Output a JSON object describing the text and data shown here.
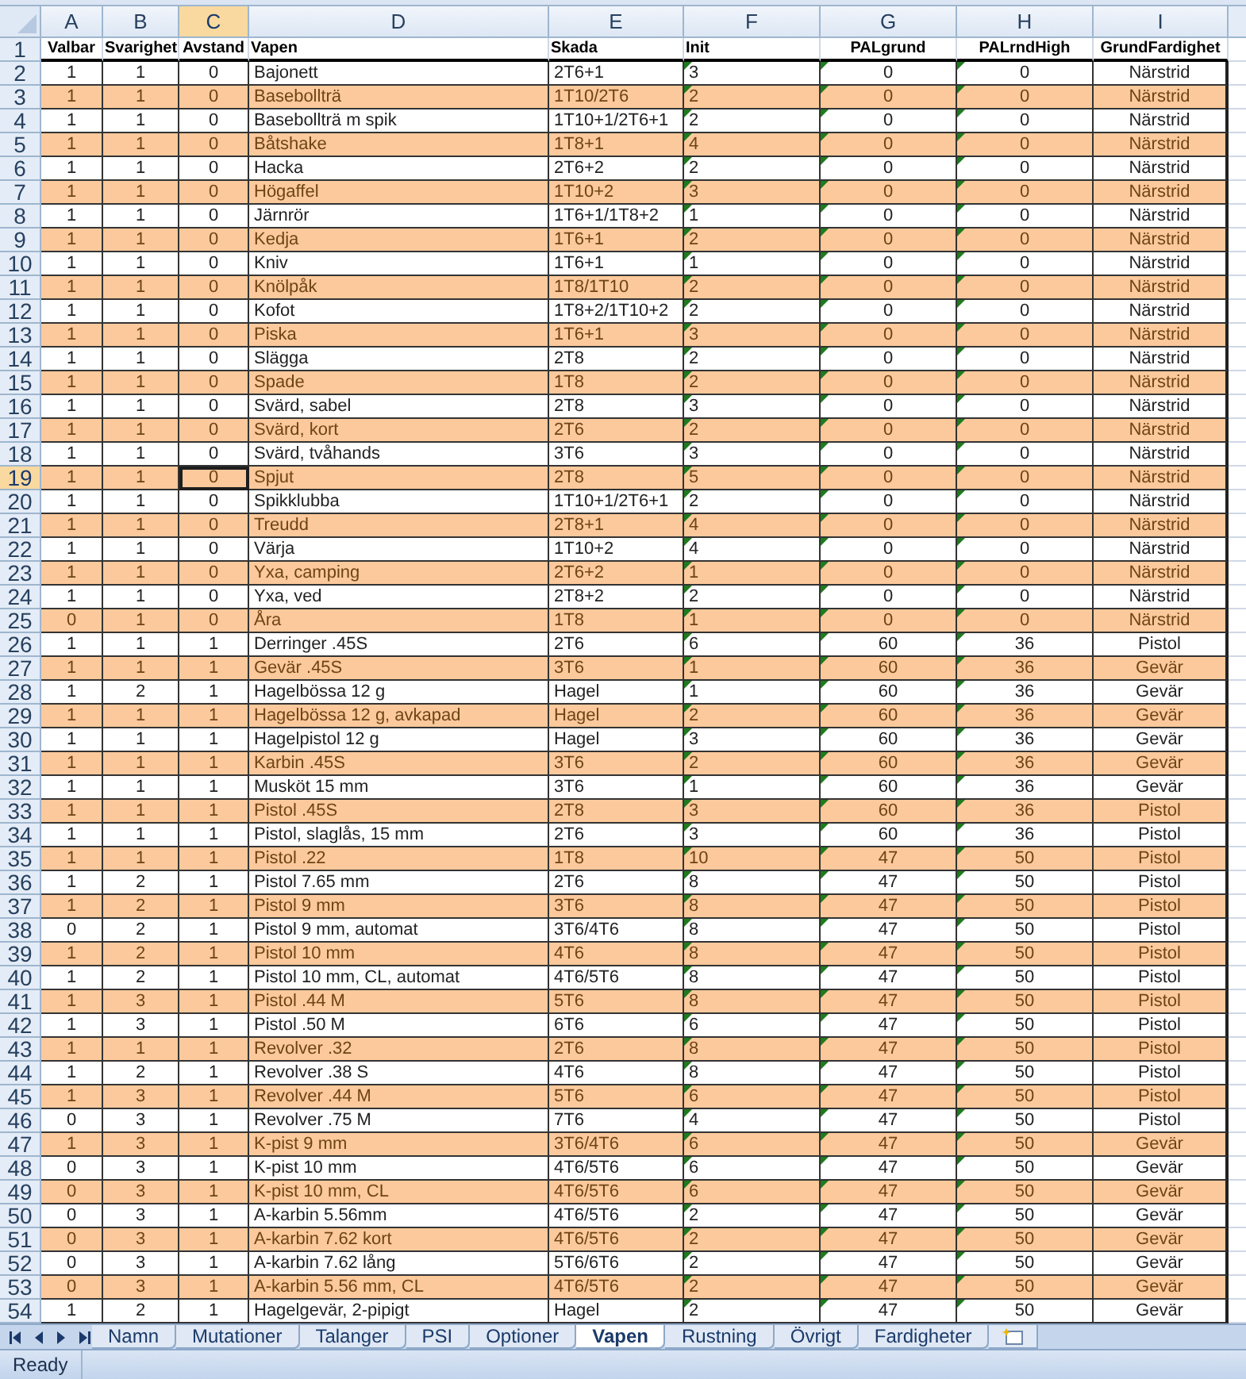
{
  "columns": [
    {
      "letter": "A",
      "header": "Valbar",
      "kind": "centered",
      "selected": false,
      "error_marks": false
    },
    {
      "letter": "B",
      "header": "Svarighet",
      "kind": "centered",
      "selected": false,
      "error_marks": false
    },
    {
      "letter": "C",
      "header": "Avstand",
      "kind": "centered",
      "selected": true,
      "error_marks": false
    },
    {
      "letter": "D",
      "header": "Vapen",
      "kind": "plain",
      "selected": false,
      "error_marks": false
    },
    {
      "letter": "E",
      "header": "Skada",
      "kind": "plain",
      "selected": false,
      "error_marks": false
    },
    {
      "letter": "F",
      "header": "Init",
      "kind": "plain",
      "selected": false,
      "error_marks": true
    },
    {
      "letter": "G",
      "header": "PALgrund",
      "kind": "centered",
      "selected": false,
      "error_marks": true
    },
    {
      "letter": "H",
      "header": "PALrndHigh",
      "kind": "centered",
      "selected": false,
      "error_marks": true
    },
    {
      "letter": "I",
      "header": "GrundFardighet",
      "kind": "centered",
      "selected": false,
      "error_marks": false
    }
  ],
  "header_row": "1",
  "rows": [
    {
      "n": "2",
      "shaded": false,
      "selected": false,
      "cells": [
        "1",
        "1",
        "0",
        "Bajonett",
        "2T6+1",
        "3",
        "0",
        "0",
        "Närstrid"
      ]
    },
    {
      "n": "3",
      "shaded": true,
      "selected": false,
      "cells": [
        "1",
        "1",
        "0",
        "Basebollträ",
        "1T10/2T6",
        "2",
        "0",
        "0",
        "Närstrid"
      ]
    },
    {
      "n": "4",
      "shaded": false,
      "selected": false,
      "cells": [
        "1",
        "1",
        "0",
        "Basebollträ m spik",
        "1T10+1/2T6+1",
        "2",
        "0",
        "0",
        "Närstrid"
      ]
    },
    {
      "n": "5",
      "shaded": true,
      "selected": false,
      "cells": [
        "1",
        "1",
        "0",
        "Båtshake",
        "1T8+1",
        "4",
        "0",
        "0",
        "Närstrid"
      ]
    },
    {
      "n": "6",
      "shaded": false,
      "selected": false,
      "cells": [
        "1",
        "1",
        "0",
        "Hacka",
        "2T6+2",
        "2",
        "0",
        "0",
        "Närstrid"
      ]
    },
    {
      "n": "7",
      "shaded": true,
      "selected": false,
      "cells": [
        "1",
        "1",
        "0",
        "Högaffel",
        "1T10+2",
        "3",
        "0",
        "0",
        "Närstrid"
      ]
    },
    {
      "n": "8",
      "shaded": false,
      "selected": false,
      "cells": [
        "1",
        "1",
        "0",
        "Järnrör",
        "1T6+1/1T8+2",
        "1",
        "0",
        "0",
        "Närstrid"
      ]
    },
    {
      "n": "9",
      "shaded": true,
      "selected": false,
      "cells": [
        "1",
        "1",
        "0",
        "Kedja",
        "1T6+1",
        "2",
        "0",
        "0",
        "Närstrid"
      ]
    },
    {
      "n": "10",
      "shaded": false,
      "selected": false,
      "cells": [
        "1",
        "1",
        "0",
        "Kniv",
        "1T6+1",
        "1",
        "0",
        "0",
        "Närstrid"
      ]
    },
    {
      "n": "11",
      "shaded": true,
      "selected": false,
      "cells": [
        "1",
        "1",
        "0",
        "Knölpåk",
        "1T8/1T10",
        "2",
        "0",
        "0",
        "Närstrid"
      ]
    },
    {
      "n": "12",
      "shaded": false,
      "selected": false,
      "cells": [
        "1",
        "1",
        "0",
        "Kofot",
        "1T8+2/1T10+2",
        "2",
        "0",
        "0",
        "Närstrid"
      ]
    },
    {
      "n": "13",
      "shaded": true,
      "selected": false,
      "cells": [
        "1",
        "1",
        "0",
        "Piska",
        "1T6+1",
        "3",
        "0",
        "0",
        "Närstrid"
      ]
    },
    {
      "n": "14",
      "shaded": false,
      "selected": false,
      "cells": [
        "1",
        "1",
        "0",
        "Slägga",
        "2T8",
        "2",
        "0",
        "0",
        "Närstrid"
      ]
    },
    {
      "n": "15",
      "shaded": true,
      "selected": false,
      "cells": [
        "1",
        "1",
        "0",
        "Spade",
        "1T8",
        "2",
        "0",
        "0",
        "Närstrid"
      ]
    },
    {
      "n": "16",
      "shaded": false,
      "selected": false,
      "cells": [
        "1",
        "1",
        "0",
        "Svärd, sabel",
        "2T8",
        "3",
        "0",
        "0",
        "Närstrid"
      ]
    },
    {
      "n": "17",
      "shaded": true,
      "selected": false,
      "cells": [
        "1",
        "1",
        "0",
        "Svärd, kort",
        "2T6",
        "2",
        "0",
        "0",
        "Närstrid"
      ]
    },
    {
      "n": "18",
      "shaded": false,
      "selected": false,
      "cells": [
        "1",
        "1",
        "0",
        "Svärd, tvåhands",
        "3T6",
        "3",
        "0",
        "0",
        "Närstrid"
      ]
    },
    {
      "n": "19",
      "shaded": true,
      "selected": true,
      "cells": [
        "1",
        "1",
        "0",
        "Spjut",
        "2T8",
        "5",
        "0",
        "0",
        "Närstrid"
      ]
    },
    {
      "n": "20",
      "shaded": false,
      "selected": false,
      "cells": [
        "1",
        "1",
        "0",
        "Spikklubba",
        "1T10+1/2T6+1",
        "2",
        "0",
        "0",
        "Närstrid"
      ]
    },
    {
      "n": "21",
      "shaded": true,
      "selected": false,
      "cells": [
        "1",
        "1",
        "0",
        "Treudd",
        "2T8+1",
        "4",
        "0",
        "0",
        "Närstrid"
      ]
    },
    {
      "n": "22",
      "shaded": false,
      "selected": false,
      "cells": [
        "1",
        "1",
        "0",
        "Värja",
        "1T10+2",
        "4",
        "0",
        "0",
        "Närstrid"
      ]
    },
    {
      "n": "23",
      "shaded": true,
      "selected": false,
      "cells": [
        "1",
        "1",
        "0",
        "Yxa, camping",
        "2T6+2",
        "1",
        "0",
        "0",
        "Närstrid"
      ]
    },
    {
      "n": "24",
      "shaded": false,
      "selected": false,
      "cells": [
        "1",
        "1",
        "0",
        "Yxa, ved",
        "2T8+2",
        "2",
        "0",
        "0",
        "Närstrid"
      ]
    },
    {
      "n": "25",
      "shaded": true,
      "selected": false,
      "cells": [
        "0",
        "1",
        "0",
        "Åra",
        "1T8",
        "1",
        "0",
        "0",
        "Närstrid"
      ]
    },
    {
      "n": "26",
      "shaded": false,
      "selected": false,
      "cells": [
        "1",
        "1",
        "1",
        "Derringer .45S",
        "2T6",
        "6",
        "60",
        "36",
        "Pistol"
      ]
    },
    {
      "n": "27",
      "shaded": true,
      "selected": false,
      "cells": [
        "1",
        "1",
        "1",
        "Gevär .45S",
        "3T6",
        "1",
        "60",
        "36",
        "Gevär"
      ]
    },
    {
      "n": "28",
      "shaded": false,
      "selected": false,
      "cells": [
        "1",
        "2",
        "1",
        "Hagelbössa 12 g",
        "Hagel",
        "1",
        "60",
        "36",
        "Gevär"
      ]
    },
    {
      "n": "29",
      "shaded": true,
      "selected": false,
      "cells": [
        "1",
        "1",
        "1",
        "Hagelbössa 12 g, avkapad",
        "Hagel",
        "2",
        "60",
        "36",
        "Gevär"
      ]
    },
    {
      "n": "30",
      "shaded": false,
      "selected": false,
      "cells": [
        "1",
        "1",
        "1",
        "Hagelpistol 12 g",
        "Hagel",
        "3",
        "60",
        "36",
        "Gevär"
      ]
    },
    {
      "n": "31",
      "shaded": true,
      "selected": false,
      "cells": [
        "1",
        "1",
        "1",
        "Karbin .45S",
        "3T6",
        "2",
        "60",
        "36",
        "Gevär"
      ]
    },
    {
      "n": "32",
      "shaded": false,
      "selected": false,
      "cells": [
        "1",
        "1",
        "1",
        "Musköt 15 mm",
        "3T6",
        "1",
        "60",
        "36",
        "Gevär"
      ]
    },
    {
      "n": "33",
      "shaded": true,
      "selected": false,
      "cells": [
        "1",
        "1",
        "1",
        "Pistol .45S",
        "2T8",
        "3",
        "60",
        "36",
        "Pistol"
      ]
    },
    {
      "n": "34",
      "shaded": false,
      "selected": false,
      "cells": [
        "1",
        "1",
        "1",
        "Pistol, slaglås, 15 mm",
        "2T6",
        "3",
        "60",
        "36",
        "Pistol"
      ]
    },
    {
      "n": "35",
      "shaded": true,
      "selected": false,
      "cells": [
        "1",
        "1",
        "1",
        "Pistol .22",
        "1T8",
        "10",
        "47",
        "50",
        "Pistol"
      ]
    },
    {
      "n": "36",
      "shaded": false,
      "selected": false,
      "cells": [
        "1",
        "2",
        "1",
        "Pistol 7.65 mm",
        "2T6",
        "8",
        "47",
        "50",
        "Pistol"
      ]
    },
    {
      "n": "37",
      "shaded": true,
      "selected": false,
      "cells": [
        "1",
        "2",
        "1",
        "Pistol 9 mm",
        "3T6",
        "8",
        "47",
        "50",
        "Pistol"
      ]
    },
    {
      "n": "38",
      "shaded": false,
      "selected": false,
      "cells": [
        "0",
        "2",
        "1",
        "Pistol 9 mm, automat",
        "3T6/4T6",
        "8",
        "47",
        "50",
        "Pistol"
      ]
    },
    {
      "n": "39",
      "shaded": true,
      "selected": false,
      "cells": [
        "1",
        "2",
        "1",
        "Pistol 10 mm",
        "4T6",
        "8",
        "47",
        "50",
        "Pistol"
      ]
    },
    {
      "n": "40",
      "shaded": false,
      "selected": false,
      "cells": [
        "1",
        "2",
        "1",
        "Pistol 10 mm, CL, automat",
        "4T6/5T6",
        "8",
        "47",
        "50",
        "Pistol"
      ]
    },
    {
      "n": "41",
      "shaded": true,
      "selected": false,
      "cells": [
        "1",
        "3",
        "1",
        "Pistol .44 M",
        "5T6",
        "8",
        "47",
        "50",
        "Pistol"
      ]
    },
    {
      "n": "42",
      "shaded": false,
      "selected": false,
      "cells": [
        "1",
        "3",
        "1",
        "Pistol .50 M",
        "6T6",
        "6",
        "47",
        "50",
        "Pistol"
      ]
    },
    {
      "n": "43",
      "shaded": true,
      "selected": false,
      "cells": [
        "1",
        "1",
        "1",
        "Revolver .32",
        "2T6",
        "8",
        "47",
        "50",
        "Pistol"
      ]
    },
    {
      "n": "44",
      "shaded": false,
      "selected": false,
      "cells": [
        "1",
        "2",
        "1",
        "Revolver .38 S",
        "4T6",
        "8",
        "47",
        "50",
        "Pistol"
      ]
    },
    {
      "n": "45",
      "shaded": true,
      "selected": false,
      "cells": [
        "1",
        "3",
        "1",
        "Revolver .44 M",
        "5T6",
        "6",
        "47",
        "50",
        "Pistol"
      ]
    },
    {
      "n": "46",
      "shaded": false,
      "selected": false,
      "cells": [
        "0",
        "3",
        "1",
        "Revolver .75 M",
        "7T6",
        "4",
        "47",
        "50",
        "Pistol"
      ]
    },
    {
      "n": "47",
      "shaded": true,
      "selected": false,
      "cells": [
        "1",
        "3",
        "1",
        "K-pist 9 mm",
        "3T6/4T6",
        "6",
        "47",
        "50",
        "Gevär"
      ]
    },
    {
      "n": "48",
      "shaded": false,
      "selected": false,
      "cells": [
        "0",
        "3",
        "1",
        "K-pist 10 mm",
        "4T6/5T6",
        "6",
        "47",
        "50",
        "Gevär"
      ]
    },
    {
      "n": "49",
      "shaded": true,
      "selected": false,
      "cells": [
        "0",
        "3",
        "1",
        "K-pist 10 mm, CL",
        "4T6/5T6",
        "6",
        "47",
        "50",
        "Gevär"
      ]
    },
    {
      "n": "50",
      "shaded": false,
      "selected": false,
      "cells": [
        "0",
        "3",
        "1",
        "A-karbin 5.56mm",
        "4T6/5T6",
        "2",
        "47",
        "50",
        "Gevär"
      ]
    },
    {
      "n": "51",
      "shaded": true,
      "selected": false,
      "cells": [
        "0",
        "3",
        "1",
        "A-karbin 7.62 kort",
        "4T6/5T6",
        "2",
        "47",
        "50",
        "Gevär"
      ]
    },
    {
      "n": "52",
      "shaded": false,
      "selected": false,
      "cells": [
        "0",
        "3",
        "1",
        "A-karbin 7.62 lång",
        "5T6/6T6",
        "2",
        "47",
        "50",
        "Gevär"
      ]
    },
    {
      "n": "53",
      "shaded": true,
      "selected": false,
      "cells": [
        "0",
        "3",
        "1",
        "A-karbin 5.56 mm, CL",
        "4T6/5T6",
        "2",
        "47",
        "50",
        "Gevär"
      ]
    },
    {
      "n": "54",
      "shaded": false,
      "selected": false,
      "cells": [
        "1",
        "2",
        "1",
        "Hagelgevär, 2-pipigt",
        "Hagel",
        "2",
        "47",
        "50",
        "Gevär"
      ]
    }
  ],
  "sheet_tabs": [
    {
      "label": "Namn",
      "selected": false
    },
    {
      "label": "Mutationer",
      "selected": false
    },
    {
      "label": "Talanger",
      "selected": false
    },
    {
      "label": "PSI",
      "selected": false
    },
    {
      "label": "Optioner",
      "selected": false
    },
    {
      "label": "Vapen",
      "selected": true
    },
    {
      "label": "Rustning",
      "selected": false
    },
    {
      "label": "Övrigt",
      "selected": false
    },
    {
      "label": "Fardigheter",
      "selected": false
    }
  ],
  "status_bar": {
    "text": "Ready"
  }
}
